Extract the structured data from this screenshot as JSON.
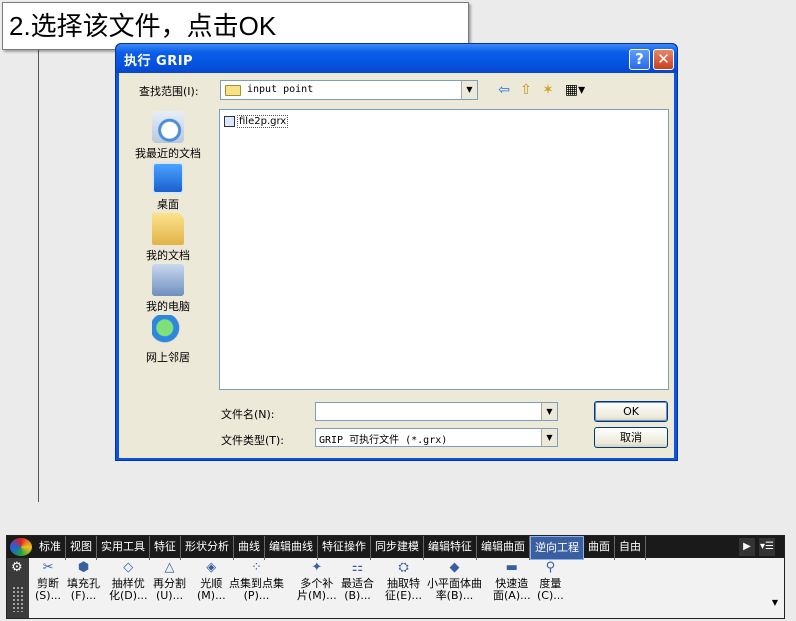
{
  "instruction": "2.选择该文件，点击OK",
  "dialog": {
    "title": "执行 GRIP",
    "help_label": "?",
    "close_label": "✕",
    "lookin_label": "查找范围(I):",
    "lookin_value": "input point",
    "places": [
      {
        "label": "我最近的文档",
        "icon": "recent-documents-icon"
      },
      {
        "label": "桌面",
        "icon": "desktop-icon"
      },
      {
        "label": "我的文档",
        "icon": "my-documents-icon"
      },
      {
        "label": "我的电脑",
        "icon": "my-computer-icon"
      },
      {
        "label": "网上邻居",
        "icon": "network-places-icon"
      }
    ],
    "files": [
      {
        "name": "file2p.grx",
        "icon": "grx-file-icon"
      }
    ],
    "filename_label": "文件名(N):",
    "filename_value": "",
    "filetype_label": "文件类型(T):",
    "filetype_value": "GRIP 可执行文件 (*.grx)",
    "ok_label": "OK",
    "cancel_label": "取消"
  },
  "ribbon": {
    "tabs": [
      "标准",
      "视图",
      "实用工具",
      "特征",
      "形状分析",
      "曲线",
      "编辑曲线",
      "特征操作",
      "同步建模",
      "编辑特征",
      "编辑曲面",
      "逆向工程",
      "曲面",
      "自由"
    ],
    "active_tab": "逆向工程",
    "tools": [
      {
        "line1": "剪断",
        "line2": "(S)...",
        "icon": "trim-icon"
      },
      {
        "line1": "填充孔",
        "line2": "(F)...",
        "icon": "fill-hole-icon"
      },
      {
        "line1": "抽样优",
        "line2": "化(D)...",
        "icon": "sample-icon"
      },
      {
        "line1": "再分割",
        "line2": "(U)...",
        "icon": "subdivide-icon"
      },
      {
        "line1": "光顺",
        "line2": "(M)...",
        "icon": "smooth-icon"
      },
      {
        "line1": "点集到点集",
        "line2": "(P)...",
        "icon": "point-set-icon"
      },
      {
        "line1": "多个补",
        "line2": "片(M)...",
        "icon": "patch-icon"
      },
      {
        "line1": "最适合",
        "line2": "(B)...",
        "icon": "best-fit-icon"
      },
      {
        "line1": "抽取特",
        "line2": "征(E)...",
        "icon": "extract-icon"
      },
      {
        "line1": "小平面体曲",
        "line2": "率(B)...",
        "icon": "curvature-icon"
      },
      {
        "line1": "快速造",
        "line2": "面(A)...",
        "icon": "rapid-surface-icon"
      },
      {
        "line1": "度量",
        "line2": "(C)...",
        "icon": "measure-icon"
      }
    ]
  }
}
